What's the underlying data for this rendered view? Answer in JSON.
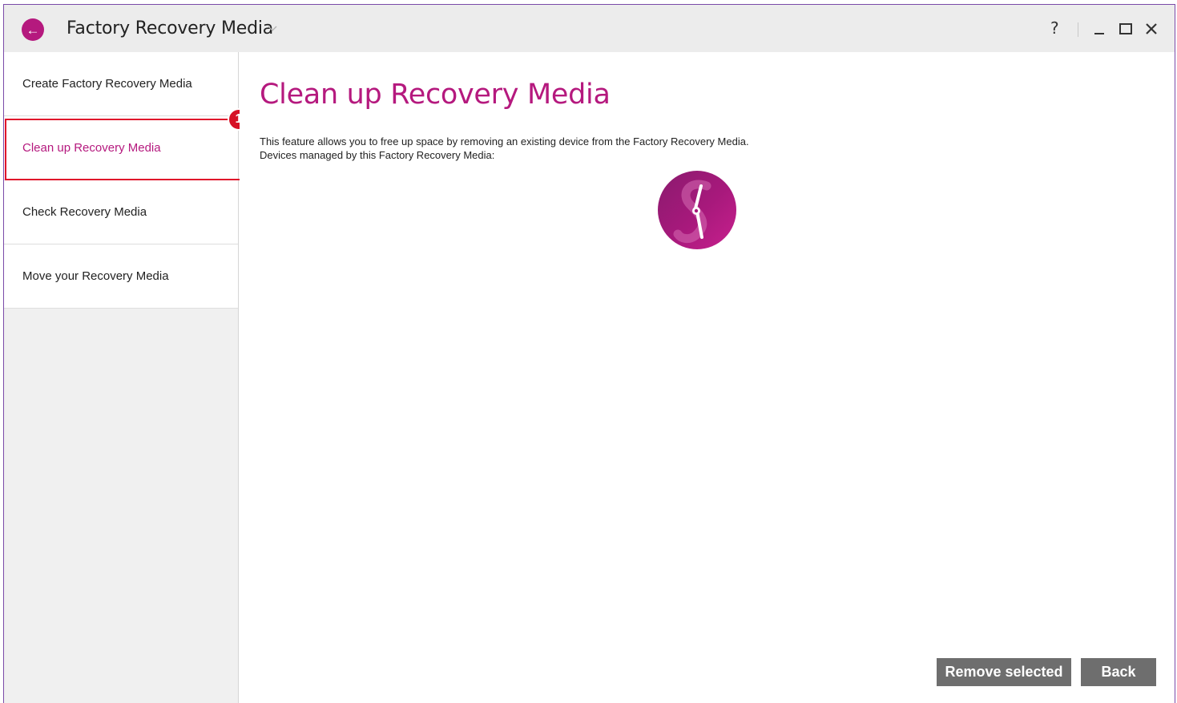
{
  "window": {
    "title": "Factory Recovery Media",
    "back_icon": "←",
    "help_label": "?"
  },
  "sidebar": {
    "items": [
      {
        "label": "Create Factory Recovery Media",
        "active": false
      },
      {
        "label": "Clean up Recovery Media",
        "active": true
      },
      {
        "label": "Check Recovery Media",
        "active": false
      },
      {
        "label": "Move your Recovery Media",
        "active": false
      }
    ],
    "step_badge": "1"
  },
  "main": {
    "title": "Clean up Recovery Media",
    "description_line1": "This feature allows you to free up space by removing an existing device from the Factory Recovery Media.",
    "description_line2": "Devices managed by this Factory Recovery Media:"
  },
  "buttons": {
    "remove_label": "Remove selected",
    "back_label": "Back"
  },
  "colors": {
    "accent": "#b5197e",
    "highlight": "#e0132b",
    "button_bg": "#6e6e6e"
  },
  "icons": {
    "back": "back-arrow-icon",
    "dropdown": "chevron-down-icon",
    "spinner": "loading-spinner-icon"
  }
}
